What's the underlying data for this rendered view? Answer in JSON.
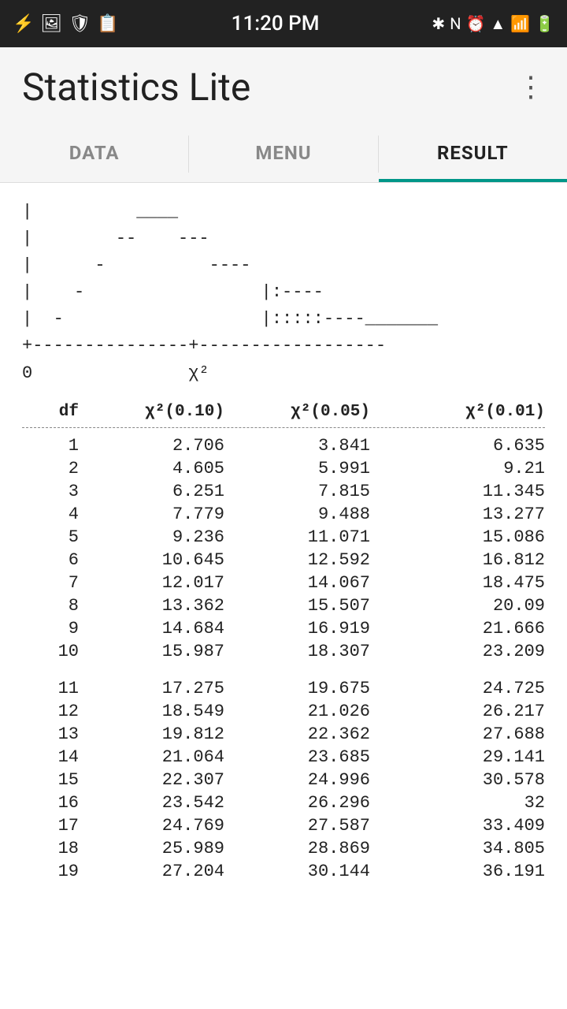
{
  "statusBar": {
    "time": "11:20 PM",
    "iconsLeft": [
      "usb",
      "image",
      "shield",
      "clipboard"
    ],
    "iconsRight": [
      "bluetooth",
      "nfc",
      "alarm",
      "wifi",
      "signal",
      "battery"
    ]
  },
  "appBar": {
    "title": "Statistics Lite",
    "menuIcon": "⋮"
  },
  "tabs": [
    {
      "label": "DATA",
      "active": false
    },
    {
      "label": "MENU",
      "active": false
    },
    {
      "label": "RESULT",
      "active": true
    }
  ],
  "asciiChart": "|          ____\n|        --    ---\n|      -          ----\n|    -                 |:----\n|  -                   |:::::----_______\n+---------------+------------------\n0               χ²",
  "table": {
    "headers": [
      "df",
      "χ²(0.10)",
      "χ²(0.05)",
      "χ²(0.01)"
    ],
    "rows": [
      [
        "1",
        "2.706",
        "3.841",
        "6.635"
      ],
      [
        "2",
        "4.605",
        "5.991",
        "9.21"
      ],
      [
        "3",
        "6.251",
        "7.815",
        "11.345"
      ],
      [
        "4",
        "7.779",
        "9.488",
        "13.277"
      ],
      [
        "5",
        "9.236",
        "11.071",
        "15.086"
      ],
      [
        "6",
        "10.645",
        "12.592",
        "16.812"
      ],
      [
        "7",
        "12.017",
        "14.067",
        "18.475"
      ],
      [
        "8",
        "13.362",
        "15.507",
        "20.09"
      ],
      [
        "9",
        "14.684",
        "16.919",
        "21.666"
      ],
      [
        "10",
        "15.987",
        "18.307",
        "23.209"
      ],
      null,
      [
        "11",
        "17.275",
        "19.675",
        "24.725"
      ],
      [
        "12",
        "18.549",
        "21.026",
        "26.217"
      ],
      [
        "13",
        "19.812",
        "22.362",
        "27.688"
      ],
      [
        "14",
        "21.064",
        "23.685",
        "29.141"
      ],
      [
        "15",
        "22.307",
        "24.996",
        "30.578"
      ],
      [
        "16",
        "23.542",
        "26.296",
        "32"
      ],
      [
        "17",
        "24.769",
        "27.587",
        "33.409"
      ],
      [
        "18",
        "25.989",
        "28.869",
        "34.805"
      ],
      [
        "19",
        "27.204",
        "30.144",
        "36.191"
      ]
    ]
  },
  "accentColor": "#009688"
}
